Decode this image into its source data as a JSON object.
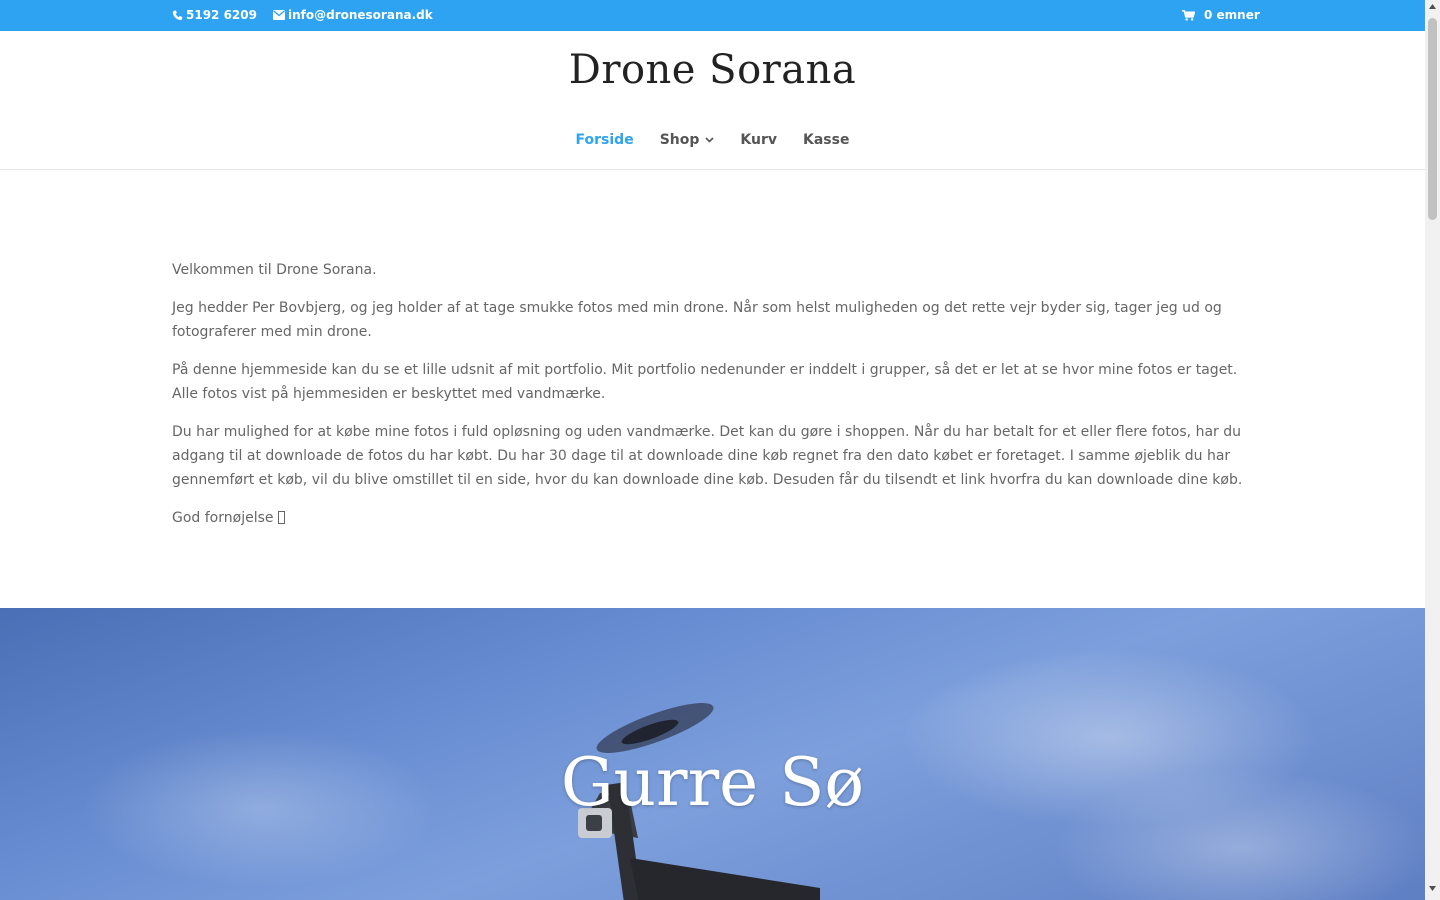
{
  "topbar": {
    "phone": "5192 6209",
    "email": "info@dronesorana.dk",
    "cart": "0 emner",
    "color": "#2ea3f2"
  },
  "header": {
    "logo": "Drone Sorana",
    "nav": [
      {
        "label": "Forside",
        "active": true
      },
      {
        "label": "Shop",
        "has_dropdown": true
      },
      {
        "label": "Kurv"
      },
      {
        "label": "Kasse"
      }
    ]
  },
  "content": {
    "paragraphs": [
      "Velkommen til Drone Sorana.",
      "Jeg hedder Per Bovbjerg, og jeg holder af at tage smukke fotos med min drone. Når som helst muligheden og det rette vejr byder sig, tager jeg ud og fotograferer med min drone.",
      "På denne hjemmeside kan du se et lille udsnit af mit portfolio. Mit portfolio nedenunder er inddelt i grupper, så det er let at se hvor mine fotos er taget. Alle fotos vist på hjemmesiden er beskyttet med vandmærke.",
      "Du har mulighed for at købe mine fotos i fuld opløsning og uden vandmærke. Det kan du gøre i shoppen. Når du har betalt for et eller flere fotos, har du adgang til at downloade de fotos du har købt. Du har 30 dage til at downloade dine køb regnet fra den dato købet er foretaget. I samme øjeblik du har gennemført et køb, vil du blive omstillet til en side, hvor du kan downloade dine køb. Desuden får du tilsendt et link hvorfra du kan downloade dine køb.",
      "God fornøjelse "
    ]
  },
  "hero": {
    "title": "Gurre Sø"
  }
}
